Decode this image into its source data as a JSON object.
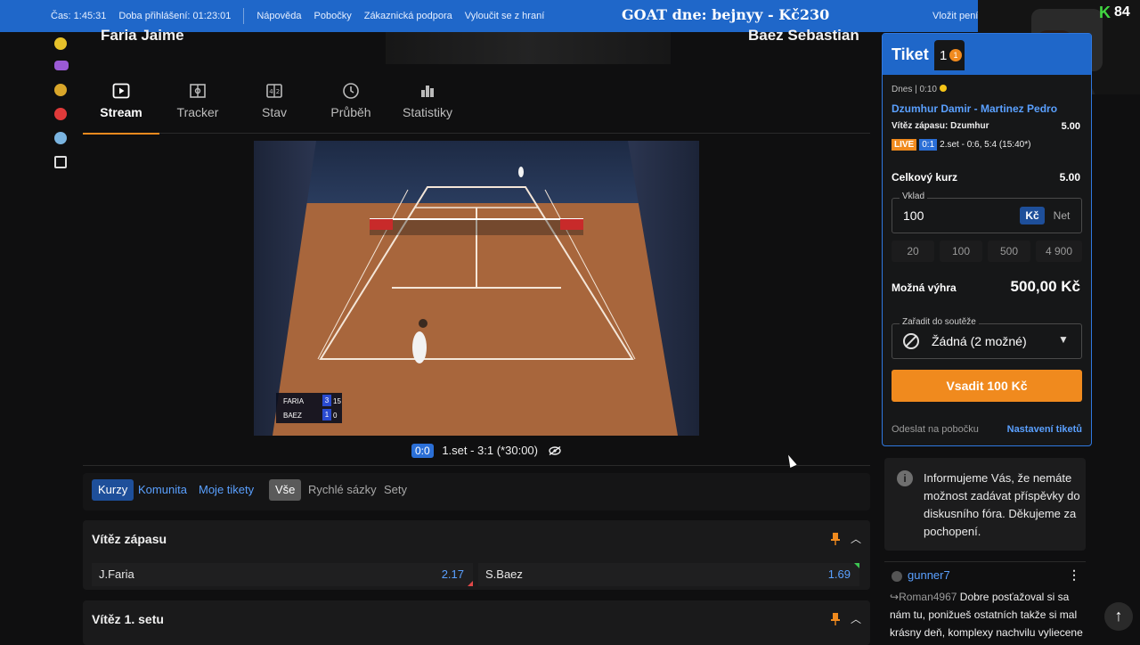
{
  "topbar": {
    "time": "Čas: 1:45:31",
    "login_duration": "Doba přihlášení: 01:23:01",
    "links": [
      "Nápověda",
      "Pobočky",
      "Zákaznická podpora",
      "Vyloučit se z hraní"
    ],
    "goat": "GOAT dne: bejnyy - Kč230",
    "deposit": "Vložit peníz"
  },
  "webcam": {
    "channel_logo": "K",
    "count": "84"
  },
  "match": {
    "player1": "Faria Jaime",
    "player2": "Baez Sebastian"
  },
  "tabs": [
    {
      "label": "Stream",
      "icon": "play-icon"
    },
    {
      "label": "Tracker",
      "icon": "tracker-icon"
    },
    {
      "label": "Stav",
      "icon": "scoreboard-icon"
    },
    {
      "label": "Průběh",
      "icon": "clock-icon"
    },
    {
      "label": "Statistiky",
      "icon": "bar-chart-icon"
    }
  ],
  "video": {
    "scoreboard": [
      {
        "name": "FARIA",
        "games": "3",
        "points": "15"
      },
      {
        "name": "BAEZ",
        "games": "1",
        "points": "0"
      }
    ],
    "status_score": "0:0",
    "status_text": "1.set - 3:1 (*30:00)"
  },
  "filters": {
    "section": [
      "Kurzy",
      "Komunita",
      "Moje tikety"
    ],
    "markets": [
      "Vše",
      "Rychlé sázky",
      "Sety"
    ]
  },
  "markets": [
    {
      "title": "Vítěz zápasu",
      "odds": [
        {
          "name": "J.Faria",
          "value": "2.17",
          "trend": "down"
        },
        {
          "name": "S.Baez",
          "value": "1.69",
          "trend": "up"
        }
      ]
    },
    {
      "title": "Vítěz 1. setu"
    }
  ],
  "ticket": {
    "title": "Tiket",
    "count": "1",
    "badge": "1",
    "time": "Dnes | 0:10",
    "match": "Dzumhur Damir - Martinez Pedro",
    "selection": "Vítěz zápasu: Dzumhur",
    "selection_odd": "5.00",
    "live_label": "LIVE",
    "live_score": "0:1",
    "live_text": "2.set - 0:6, 5:4 (15:40*)",
    "total_label": "Celkový kurz",
    "total_value": "5.00",
    "stake_label": "Vklad",
    "stake_value": "100",
    "currency_kc": "Kč",
    "currency_net": "Net",
    "quick_stakes": [
      "20",
      "100",
      "500",
      "4 900"
    ],
    "win_label": "Možná výhra",
    "win_value": "500,00 Kč",
    "competition_label": "Zařadit do soutěže",
    "competition_value": "Žádná (2 možné)",
    "bet_button": "Vsadit 100 Kč",
    "send_branch": "Odeslat na pobočku",
    "settings": "Nastavení tiketů"
  },
  "info": {
    "text": "Informujeme Vás, že nemáte možnost zadávat příspěvky do diskusního fóra. Děkujeme za pochopení."
  },
  "comment": {
    "user": "gunner7",
    "reply_to": "Roman4967",
    "text": "Dobre posťažoval si sa nám tu, ponižueš ostatních takže si mal krásny deň, komplexy nachvilu vyliecene"
  },
  "colors": {
    "brand_blue": "#1f67c9",
    "accent_orange": "#f08a1e",
    "odds_blue": "#5aa0ff"
  }
}
